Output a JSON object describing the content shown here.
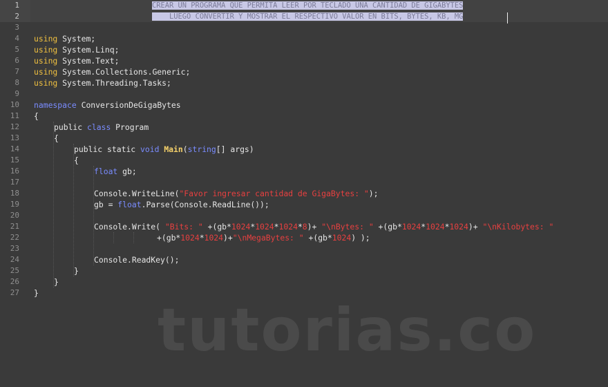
{
  "editor": {
    "line_numbers": [
      "1",
      "2",
      "3",
      "4",
      "5",
      "6",
      "7",
      "8",
      "9",
      "10",
      "11",
      "12",
      "13",
      "14",
      "15",
      "16",
      "17",
      "18",
      "19",
      "20",
      "21",
      "22",
      "23",
      "24",
      "25",
      "26",
      "27"
    ],
    "comment_line1": "CREAR UN PROGRAMA QUE PERMITA LEER POR TECLADO UNA CANTIDAD DE GIGABYTES",
    "comment_line2": "LUEGO CONVERTIR Y MOSTRAR EL RESPECTIVO VALOR EN BITS, BYTES, KB, MG",
    "usings": [
      "System;",
      "System.Linq;",
      "System.Text;",
      "System.Collections.Generic;",
      "System.Threading.Tasks;"
    ],
    "kw_using": "using",
    "kw_namespace": "namespace",
    "namespace_name": "ConversionDeGigaBytes",
    "kw_public": "public",
    "kw_class": "class",
    "class_name": "Program",
    "kw_static": "static",
    "kw_void": "void",
    "main_name": "Main",
    "kw_string": "string",
    "main_args": "[] args)",
    "kw_float": "float",
    "decl_var": " gb;",
    "writeline_call": "Console.WriteLine(",
    "writeline_str": "\"Favor ingresar cantidad de GigaBytes: \"",
    "writeline_end": ");",
    "parse_pre": "gb = ",
    "parse_post": ".Parse(Console.ReadLine());",
    "write_call": "Console.Write( ",
    "bits_str": "\"Bits: \"",
    "expr_bits": " +(gb*",
    "n1024": "1024",
    "n8": "8",
    "esc_n": "\\n",
    "bytes_lbl": "Bytes: \"",
    "kilobytes_lbl": "Kilobytes: \"",
    "megabytes_lbl": "MegaBytes: \"",
    "readkey_call": "Console.ReadKey();",
    "open_brace": "{",
    "close_brace": "}"
  },
  "watermark": "tutorias.co"
}
